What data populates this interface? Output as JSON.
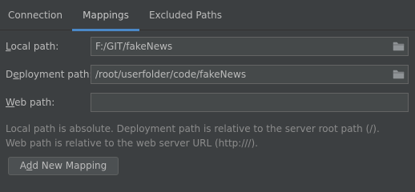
{
  "tabs": {
    "connection": "Connection",
    "mappings": "Mappings",
    "excluded": "Excluded Paths",
    "active": "Mappings"
  },
  "form": {
    "local_path": {
      "label_mnemonic": "L",
      "label_rest": "ocal path:",
      "value": "F:/GIT/fakeNews",
      "icon": "folder-icon"
    },
    "deployment_path": {
      "label_pre": "D",
      "label_mnemonic": "e",
      "label_rest": "ployment path:",
      "value": "/root/userfolder/code/fakeNews",
      "icon": "folder-icon"
    },
    "web_path": {
      "label_mnemonic": "W",
      "label_rest": "eb path:",
      "value": ""
    }
  },
  "hints": {
    "line1": "Local path is absolute. Deployment path is relative to the server root path (/).",
    "line2": "Web path is relative to the web server URL (http:///)."
  },
  "buttons": {
    "add_pre": "A",
    "add_mnemonic": "d",
    "add_rest": "d New Mapping"
  },
  "colors": {
    "background": "#3c3f41",
    "field_bg": "#45494a",
    "field_border": "#646464",
    "accent": "#4a88c7",
    "text": "#bbbbbb",
    "hint_text": "#8c8c8c"
  }
}
